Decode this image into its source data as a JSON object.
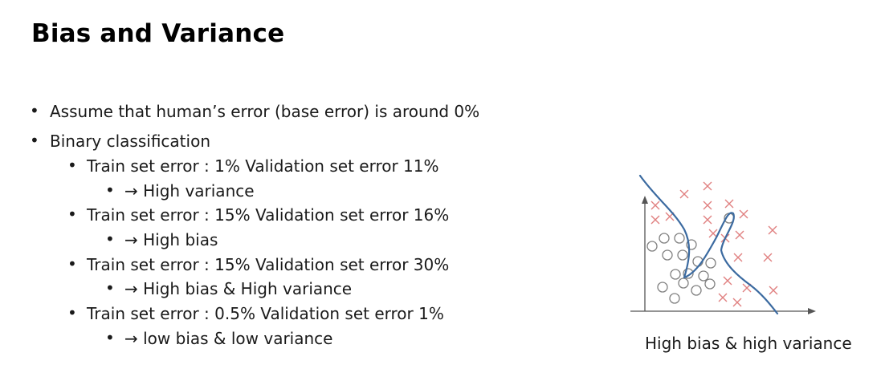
{
  "slide": {
    "title": "Bias and Variance",
    "bullets": [
      {
        "text": "Assume that human’s error (base error) is around 0%",
        "level": 1
      },
      {
        "text": "Binary classification",
        "level": 1
      },
      {
        "text": "Train set error : 1% Validation set error 11%",
        "level": 2
      },
      {
        "text": "→ High variance",
        "level": 3
      },
      {
        "text": "Train set error : 15% Validation set error 16%",
        "level": 2
      },
      {
        "text": "→ High bias",
        "level": 3
      },
      {
        "text": "Train set error : 15% Validation set error 30%",
        "level": 2
      },
      {
        "text": "→ High bias & High variance",
        "level": 3
      },
      {
        "text": "Train set error : 0.5% Validation set error 1%",
        "level": 2
      },
      {
        "text": "→ low bias & low variance",
        "level": 3
      }
    ],
    "bullet_glyph": "•",
    "figure": {
      "caption": "High bias & high variance",
      "boundary_color": "#3b6aa0",
      "cross_color": "#e08080",
      "circle_color": "#808080"
    }
  }
}
